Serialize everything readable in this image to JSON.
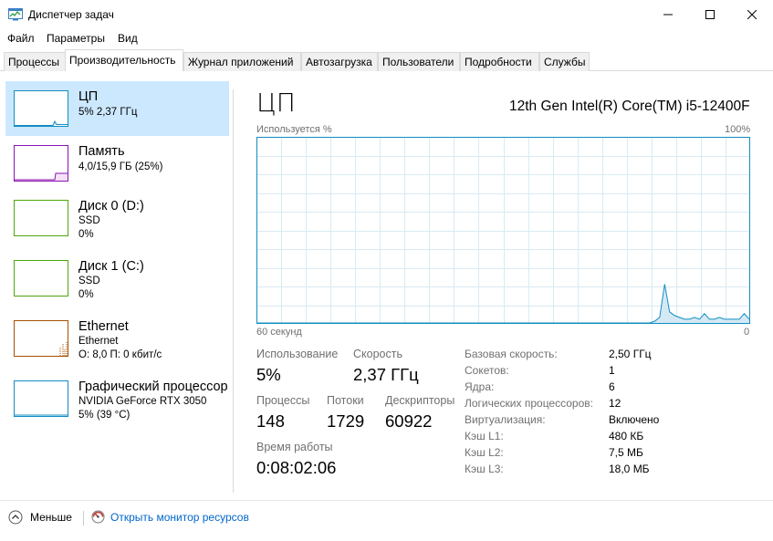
{
  "window": {
    "title": "Диспетчер задач"
  },
  "menu": [
    "Файл",
    "Параметры",
    "Вид"
  ],
  "tabs": [
    {
      "label": "Процессы",
      "active": false
    },
    {
      "label": "Производительность",
      "active": true
    },
    {
      "label": "Журнал приложений",
      "active": false
    },
    {
      "label": "Автозагрузка",
      "active": false
    },
    {
      "label": "Пользователи",
      "active": false
    },
    {
      "label": "Подробности",
      "active": false
    },
    {
      "label": "Службы",
      "active": false
    }
  ],
  "sidebar": {
    "items": [
      {
        "title": "ЦП",
        "lines": [
          "5% 2,37 ГГц"
        ],
        "color": "#118dc2",
        "selected": true
      },
      {
        "title": "Память",
        "lines": [
          "4,0/15,9 ГБ (25%)"
        ],
        "color": "#8b12ae",
        "selected": false
      },
      {
        "title": "Диск 0 (D:)",
        "lines": [
          "SSD",
          "0%"
        ],
        "color": "#4da60c",
        "selected": false
      },
      {
        "title": "Диск 1 (C:)",
        "lines": [
          "SSD",
          "0%"
        ],
        "color": "#4da60c",
        "selected": false
      },
      {
        "title": "Ethernet",
        "lines": [
          "Ethernet",
          "О: 8,0 П: 0 кбит/с"
        ],
        "color": "#a74f01",
        "selected": false
      },
      {
        "title": "Графический процессор",
        "lines": [
          "NVIDIA GeForce RTX 3050",
          "5% (39 °C)"
        ],
        "color": "#118dc2",
        "selected": false
      }
    ]
  },
  "main": {
    "title": "ЦП",
    "model": "12th Gen Intel(R) Core(TM) i5-12400F",
    "graph": {
      "top_left": "Используется %",
      "top_right": "100%",
      "bottom_left": "60 секунд",
      "bottom_right": "0",
      "line_color": "#118dc2",
      "fill_color": "#d5e9f5",
      "grid_color": "#d9eaf4",
      "usage_percent": [
        0,
        0,
        0,
        0,
        0,
        0,
        0,
        0,
        0,
        0,
        0,
        0,
        0,
        0,
        0,
        0,
        0,
        0,
        0,
        0,
        0,
        0,
        0,
        0,
        0,
        0,
        0,
        0,
        0,
        0,
        0,
        0,
        0,
        0,
        0,
        0,
        0,
        0,
        0,
        0,
        0,
        0,
        0,
        0,
        0,
        0,
        0,
        0,
        0,
        0,
        0,
        0,
        0,
        0,
        0,
        0,
        0,
        0,
        0,
        0,
        0,
        0,
        0,
        0,
        0,
        0,
        0,
        0,
        0,
        0,
        0,
        0,
        0,
        0,
        0,
        0,
        0,
        0,
        0,
        0,
        1,
        3,
        21,
        6,
        4,
        3,
        2,
        2,
        3,
        2,
        5,
        2,
        2,
        3,
        2,
        2,
        2,
        2,
        5,
        2
      ]
    },
    "stats": {
      "usage_label": "Использование",
      "usage_value": "5%",
      "speed_label": "Скорость",
      "speed_value": "2,37 ГГц",
      "processes_label": "Процессы",
      "processes_value": "148",
      "threads_label": "Потоки",
      "threads_value": "1729",
      "handles_label": "Дескрипторы",
      "handles_value": "60922",
      "uptime_label": "Время работы",
      "uptime_value": "0:08:02:06"
    },
    "details": [
      {
        "key": "Базовая скорость:",
        "value": "2,50 ГГц"
      },
      {
        "key": "Сокетов:",
        "value": "1"
      },
      {
        "key": "Ядра:",
        "value": "6"
      },
      {
        "key": "Логических процессоров:",
        "value": "12"
      },
      {
        "key": "Виртуализация:",
        "value": "Включено"
      },
      {
        "key": "Кэш L1:",
        "value": "480 КБ"
      },
      {
        "key": "Кэш L2:",
        "value": "7,5 МБ"
      },
      {
        "key": "Кэш L3:",
        "value": "18,0 МБ"
      }
    ]
  },
  "footer": {
    "fewer": "Меньше",
    "monitor": "Открыть монитор ресурсов"
  }
}
